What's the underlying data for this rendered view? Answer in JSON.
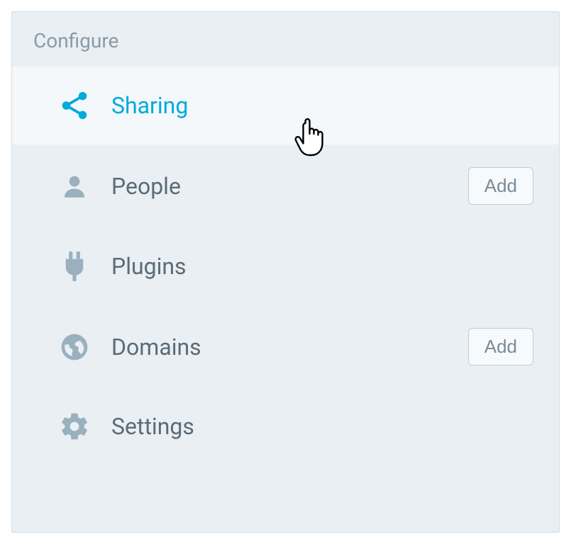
{
  "panel": {
    "title": "Configure"
  },
  "menu": {
    "sharing": {
      "label": "Sharing"
    },
    "people": {
      "label": "People",
      "action": "Add"
    },
    "plugins": {
      "label": "Plugins"
    },
    "domains": {
      "label": "Domains",
      "action": "Add"
    },
    "settings": {
      "label": "Settings"
    }
  },
  "colors": {
    "accent": "#00aadc",
    "muted": "#9bb0bf",
    "text": "#5b6b78"
  }
}
